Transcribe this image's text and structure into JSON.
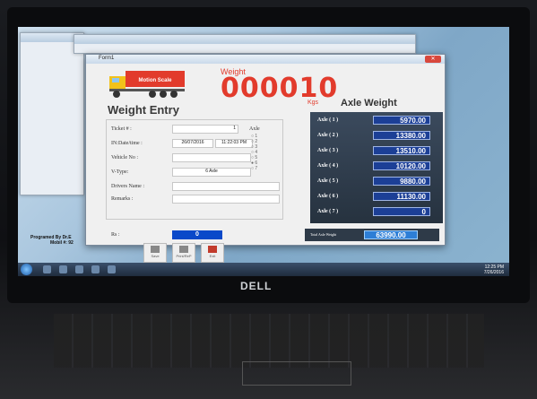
{
  "form": {
    "brand_text": "Motion Scale",
    "weight_label": "Weight",
    "weight_value": "000010",
    "weight_unit": "Kgs",
    "entry_title": "Weight Entry",
    "fields": {
      "ticket_label": "Ticket # :",
      "ticket_value": "1",
      "in_datetime_label": "IN:Date/time :",
      "in_date_value": "26/07/2016",
      "in_time_value": "11:22:03 PM",
      "vehicle_label": "Vehicle No :",
      "vehicle_value": "",
      "vtype_label": "V-Type:",
      "vtype_value": "6 Axle",
      "drivers_label": "Drivers Name :",
      "drivers_value": "",
      "remarks_label": "Remarks :",
      "remarks_value": "",
      "rs_label": "Rs :",
      "rs_value": "0"
    },
    "axle_selector": {
      "label": "Axle",
      "options": [
        "1",
        "2",
        "3",
        "4",
        "5",
        "6",
        "7"
      ]
    },
    "axle_weight_title": "Axle Weight",
    "axles": [
      {
        "label": "Axle ( 1 )",
        "value": "5970.00"
      },
      {
        "label": "Axle ( 2 )",
        "value": "13380.00"
      },
      {
        "label": "Axle ( 3 )",
        "value": "13510.00"
      },
      {
        "label": "Axle ( 4 )",
        "value": "10120.00"
      },
      {
        "label": "Axle ( 5 )",
        "value": "9880.00"
      },
      {
        "label": "Axle ( 6 )",
        "value": "11130.00"
      },
      {
        "label": "Axle ( 7 )",
        "value": "0"
      }
    ],
    "total_label": "Total Axle Weight",
    "total_value": "63990.00",
    "buttons": {
      "save": "Save",
      "print": "Print/ReP",
      "exit": "Exit"
    }
  },
  "background": {
    "credit_line1": "Programed By Dr.E",
    "credit_line2": "Mobil #: 92"
  },
  "brand": {
    "laptop": "DELL"
  },
  "colors": {
    "weight_red": "#e23b2c",
    "axle_value_bg": "#1c3f96",
    "total_value_bg": "#2d7ed6"
  }
}
